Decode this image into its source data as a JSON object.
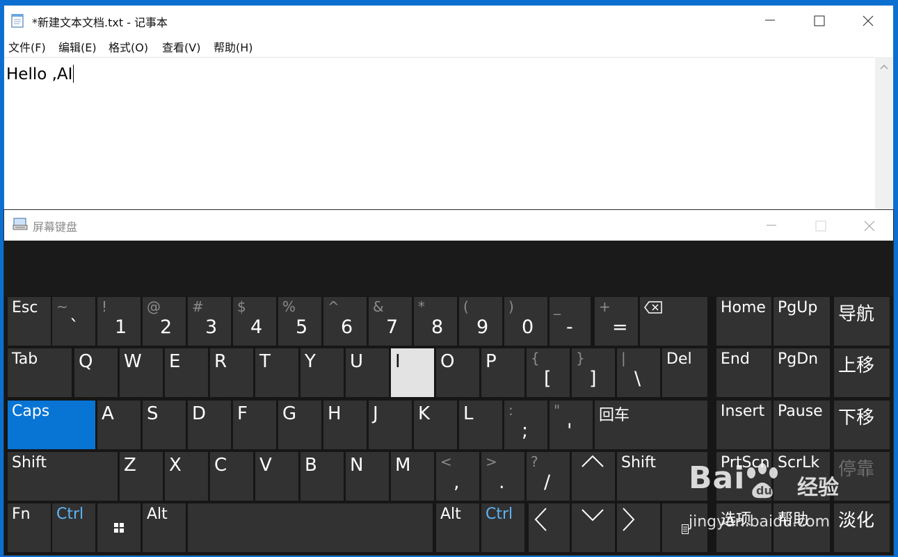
{
  "notepad": {
    "title": "*新建文本文档.txt - 记事本",
    "menu": [
      "文件(F)",
      "编辑(E)",
      "格式(O)",
      "查看(V)",
      "帮助(H)"
    ],
    "content": "Hello ,AI"
  },
  "osk": {
    "title": "屏幕键盘",
    "row1": [
      {
        "main": "Esc"
      },
      {
        "top": "~",
        "main": "`"
      },
      {
        "top": "!",
        "main": "1"
      },
      {
        "top": "@",
        "main": "2"
      },
      {
        "top": "#",
        "main": "3"
      },
      {
        "top": "$",
        "main": "4"
      },
      {
        "top": "%",
        "main": "5"
      },
      {
        "top": "^",
        "main": "6"
      },
      {
        "top": "&",
        "main": "7"
      },
      {
        "top": "*",
        "main": "8"
      },
      {
        "top": "(",
        "main": "9"
      },
      {
        "top": ")",
        "main": "0"
      },
      {
        "top": "_",
        "main": "-"
      },
      {
        "top": "+",
        "main": "="
      }
    ],
    "row2": [
      {
        "main": "Tab"
      },
      {
        "main": "Q"
      },
      {
        "main": "W"
      },
      {
        "main": "E"
      },
      {
        "main": "R"
      },
      {
        "main": "T"
      },
      {
        "main": "Y"
      },
      {
        "main": "U"
      },
      {
        "main": "I"
      },
      {
        "main": "O"
      },
      {
        "main": "P"
      },
      {
        "top": "{",
        "main": "["
      },
      {
        "top": "}",
        "main": "]"
      },
      {
        "top": "|",
        "main": "\\"
      },
      {
        "main": "Del"
      }
    ],
    "row3": [
      {
        "main": "Caps"
      },
      {
        "main": "A"
      },
      {
        "main": "S"
      },
      {
        "main": "D"
      },
      {
        "main": "F"
      },
      {
        "main": "G"
      },
      {
        "main": "H"
      },
      {
        "main": "J"
      },
      {
        "main": "K"
      },
      {
        "main": "L"
      },
      {
        "top": ":",
        "main": ";"
      },
      {
        "top": "\"",
        "main": "'"
      },
      {
        "main": "回车"
      }
    ],
    "row4": [
      {
        "main": "Shift"
      },
      {
        "main": "Z"
      },
      {
        "main": "X"
      },
      {
        "main": "C"
      },
      {
        "main": "V"
      },
      {
        "main": "B"
      },
      {
        "main": "N"
      },
      {
        "main": "M"
      },
      {
        "top": "<",
        "main": ","
      },
      {
        "top": ">",
        "main": "."
      },
      {
        "top": "?",
        "main": "/"
      },
      {
        "main": "Shift"
      }
    ],
    "row5": [
      {
        "main": "Fn"
      },
      {
        "main": "Ctrl"
      },
      {
        "main": "Alt"
      },
      {
        "main": "Alt"
      },
      {
        "main": "Ctrl"
      }
    ],
    "side": {
      "home": "Home",
      "pgup": "PgUp",
      "nav": "导航",
      "end": "End",
      "pgdn": "PgDn",
      "moveup": "上移",
      "insert": "Insert",
      "pause": "Pause",
      "movedown": "下移",
      "prtscn": "PrtScn",
      "scrlk": "ScrLk",
      "dock": "停靠",
      "options": "选项",
      "help": "帮助",
      "fade": "淡化"
    },
    "pressed_key": "I",
    "active_key": "Caps",
    "accent_color": "#0874d4"
  },
  "watermark": {
    "brand": "Bai",
    "brand2": "经验",
    "url": "jingyan.baidu.com"
  }
}
